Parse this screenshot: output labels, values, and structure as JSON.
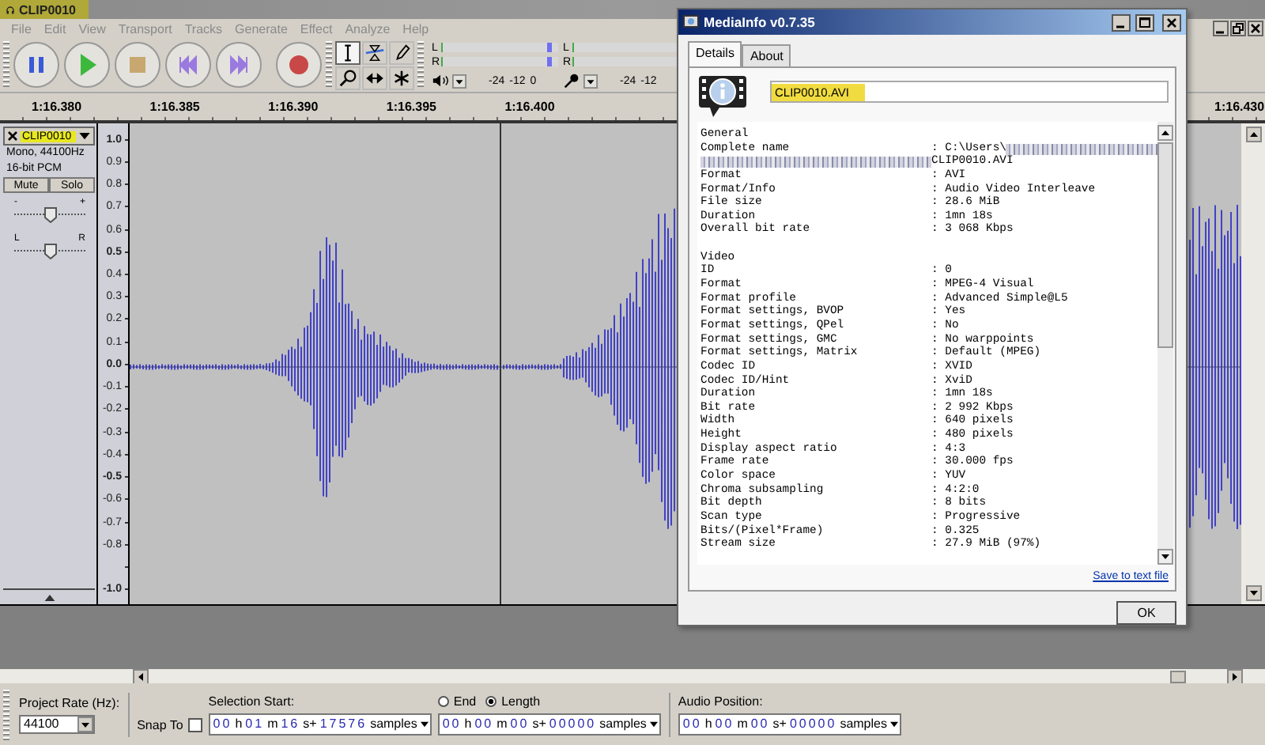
{
  "window": {
    "title": "CLIP0010"
  },
  "menu": [
    {
      "label": "File",
      "disabled": true
    },
    {
      "label": "Edit",
      "disabled": true
    },
    {
      "label": "View",
      "disabled": true
    },
    {
      "label": "Transport",
      "disabled": true
    },
    {
      "label": "Tracks",
      "disabled": true
    },
    {
      "label": "Generate",
      "disabled": true
    },
    {
      "label": "Effect",
      "disabled": true
    },
    {
      "label": "Analyze",
      "disabled": true
    },
    {
      "label": "Help",
      "disabled": true
    }
  ],
  "meters": [
    {
      "channels": [
        "L",
        "R"
      ],
      "ticks": [
        "-24",
        "-12",
        "0"
      ]
    },
    {
      "channels": [
        "L",
        "R"
      ],
      "ticks": [
        "-24",
        "-12"
      ]
    }
  ],
  "ruler": [
    "1:16.380",
    "1:16.385",
    "1:16.390",
    "1:16.395",
    "1:16.400",
    "1:16.430"
  ],
  "track": {
    "name": "CLIP0010",
    "highlighted": true,
    "info": [
      "Mono, 44100Hz",
      "16-bit PCM"
    ],
    "buttons": [
      "Mute",
      "Solo"
    ],
    "gain": {
      "min": "-",
      "max": "+",
      "level": 0.5
    },
    "pan": {
      "min": "L",
      "max": "R",
      "level": 0.5
    },
    "scale": [
      "1.0",
      "0.9",
      "0.8",
      "0.7",
      "0.6",
      "0.5",
      "0.4",
      "0.3",
      "0.2",
      "0.1",
      "0.0",
      "-0.1",
      "-0.2",
      "-0.3",
      "-0.4",
      "-0.5",
      "-0.6",
      "-0.7",
      "-0.8",
      "-1.0"
    ]
  },
  "selection_bar": {
    "project_rate": {
      "label": "Project Rate (Hz):",
      "value": "44100"
    },
    "snap": {
      "label": "Snap To",
      "checked": false
    },
    "selection_start": {
      "label": "Selection Start:",
      "segments": [
        "00",
        "h",
        "01",
        "m",
        "16",
        "s+",
        "17576",
        "samples"
      ]
    },
    "end_length": {
      "options": [
        {
          "label": "End",
          "selected": false
        },
        {
          "label": "Length",
          "selected": true
        }
      ],
      "segments": [
        "00",
        "h",
        "00",
        "m",
        "00",
        "s+",
        "00000",
        "samples"
      ]
    },
    "audio_position": {
      "label": "Audio Position:",
      "segments": [
        "00",
        "h",
        "00",
        "m",
        "00",
        "s+",
        "00000",
        "samples"
      ]
    }
  },
  "mediainfo": {
    "title": "MediaInfo v0.7.35",
    "tabs": [
      {
        "label": "Details",
        "selected": true
      },
      {
        "label": "About",
        "selected": false
      }
    ],
    "file_field": {
      "value": "CLIP0010.AVI",
      "highlighted": true
    },
    "sections": [
      {
        "title": "General",
        "rows": [
          {
            "label": "Complete name",
            "value": ": C:\\Users\\",
            "continuation": "CLIP0010.AVI"
          },
          {
            "label": "Format",
            "value": ": AVI"
          },
          {
            "label": "Format/Info",
            "value": ": Audio Video Interleave"
          },
          {
            "label": "File size",
            "value": ": 28.6 MiB"
          },
          {
            "label": "Duration",
            "value": ": 1mn 18s"
          },
          {
            "label": "Overall bit rate",
            "value": ": 3 068 Kbps"
          }
        ]
      },
      {
        "title": "Video",
        "rows": [
          {
            "label": "ID",
            "value": ": 0"
          },
          {
            "label": "Format",
            "value": ": MPEG-4 Visual"
          },
          {
            "label": "Format profile",
            "value": ": Advanced Simple@L5"
          },
          {
            "label": "Format settings, BVOP",
            "value": ": Yes"
          },
          {
            "label": "Format settings, QPel",
            "value": ": No"
          },
          {
            "label": "Format settings, GMC",
            "value": ": No warppoints"
          },
          {
            "label": "Format settings, Matrix",
            "value": ": Default (MPEG)"
          },
          {
            "label": "Codec ID",
            "value": ": XVID"
          },
          {
            "label": "Codec ID/Hint",
            "value": ": XviD"
          },
          {
            "label": "Duration",
            "value": ": 1mn 18s"
          },
          {
            "label": "Bit rate",
            "value": ": 2 992 Kbps"
          },
          {
            "label": "Width",
            "value": ": 640 pixels"
          },
          {
            "label": "Height",
            "value": ": 480 pixels"
          },
          {
            "label": "Display aspect ratio",
            "value": ": 4:3"
          },
          {
            "label": "Frame rate",
            "value": ": 30.000 fps"
          },
          {
            "label": "Color space",
            "value": ": YUV"
          },
          {
            "label": "Chroma subsampling",
            "value": ": 4:2:0"
          },
          {
            "label": "Bit depth",
            "value": ": 8 bits"
          },
          {
            "label": "Scan type",
            "value": ": Progressive"
          },
          {
            "label": "Bits/(Pixel*Frame)",
            "value": ": 0.325"
          },
          {
            "label": "Stream size",
            "value": ": 27.9 MiB (97%)"
          }
        ]
      }
    ],
    "link": "Save to text file",
    "ok": "OK"
  }
}
